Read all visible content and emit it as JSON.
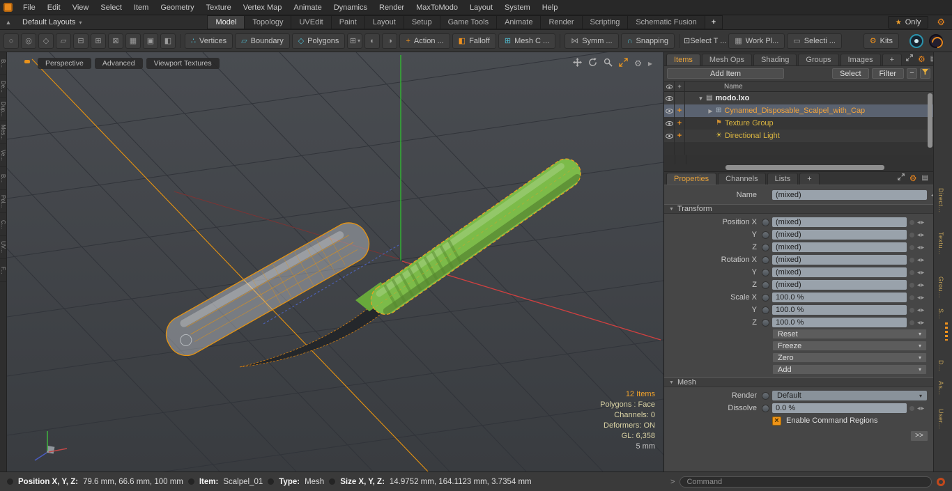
{
  "colors": {
    "accent_orange": "#f5911e",
    "selection_orange": "#f2a43e",
    "axis_green": "#2fc12f",
    "axis_red": "#d14040",
    "handle_green": "#7cbb49",
    "field_gray": "#99a2ab"
  },
  "icons": {
    "gear": "⚙",
    "star": "★",
    "dropdown": "▾",
    "triangle_down": "▼",
    "triangle_right": "▶",
    "film": "▤",
    "mesh": "⊞",
    "flag": "⚑",
    "sun": "☀",
    "plus": "+",
    "minus": "−",
    "arrows_lr": "◀▶",
    "up": "▲",
    "check_x": "×",
    "list": "▤"
  },
  "menu_bar": {
    "items": [
      "File",
      "Edit",
      "View",
      "Select",
      "Item",
      "Geometry",
      "Texture",
      "Vertex Map",
      "Animate",
      "Dynamics",
      "Render",
      "MaxToModo",
      "Layout",
      "System",
      "Help"
    ]
  },
  "layout_bar": {
    "preset": "Default Layouts",
    "tabs": [
      "Model",
      "Topology",
      "UVEdit",
      "Paint",
      "Layout",
      "Setup",
      "Game Tools",
      "Animate",
      "Render",
      "Scripting",
      "Schematic Fusion"
    ],
    "add_tab": "+",
    "only_label": "Only"
  },
  "toolbar": {
    "icon_glyphs": [
      "○",
      "◎",
      "◇",
      "▱",
      "⊟",
      "⊞",
      "⊠",
      "▦",
      "▣",
      "◧",
      "◐",
      "◑"
    ],
    "buttons": [
      {
        "label": "Vertices",
        "icon": "∴"
      },
      {
        "label": "Boundary",
        "icon": "▱"
      },
      {
        "label": "Polygons",
        "icon": "◇"
      },
      {
        "label": "Action ...",
        "icon": "+"
      },
      {
        "label": "Falloff",
        "icon": "◧"
      },
      {
        "label": "Mesh C ...",
        "icon": "⊞"
      },
      {
        "label": "Symm ...",
        "icon": "⋈"
      },
      {
        "label": "Snapping",
        "icon": "∩"
      },
      {
        "label": "Select T ...",
        "icon": "⊡"
      },
      {
        "label": "Work Pl...",
        "icon": "▦"
      },
      {
        "label": "Selecti ...",
        "icon": "▭"
      },
      {
        "label": "Kits",
        "icon": "⚙"
      }
    ]
  },
  "left_tabs": [
    "B...",
    "De...",
    "Dup...",
    "Mes...",
    "Ve...",
    "B...",
    "Pol...",
    "C...",
    "UV...",
    "F..."
  ],
  "viewport": {
    "modes": [
      "Perspective",
      "Advanced",
      "Viewport Textures"
    ],
    "info": {
      "items": "12 Items",
      "polygons": "Polygons : Face",
      "channels": "Channels: 0",
      "deformers": "Deformers: ON",
      "gl": "GL: 6,358",
      "scale": "5 mm"
    }
  },
  "item_panel": {
    "tabs": [
      "Items",
      "Mesh Ops",
      "Shading",
      "Groups",
      "Images"
    ],
    "add_tab": "+",
    "add_item": "Add Item",
    "select": "Select",
    "filter": "Filter",
    "name_header": "Name",
    "rows": [
      {
        "name": "modo.lxo"
      },
      {
        "name": "Cynamed_Disposable_Scalpel_with_Cap"
      },
      {
        "name": "Texture Group"
      },
      {
        "name": "Directional Light"
      }
    ]
  },
  "properties": {
    "tabs": [
      "Properties",
      "Channels",
      "Lists"
    ],
    "add_tab": "+",
    "name_label": "Name",
    "name_value": "(mixed)",
    "sections": {
      "transform": "Transform",
      "mesh": "Mesh"
    },
    "transform_rows": [
      {
        "label": "Position X",
        "value": "(mixed)"
      },
      {
        "label": "Y",
        "value": "(mixed)"
      },
      {
        "label": "Z",
        "value": "(mixed)"
      },
      {
        "label": "Rotation X",
        "value": "(mixed)"
      },
      {
        "label": "Y",
        "value": "(mixed)"
      },
      {
        "label": "Z",
        "value": "(mixed)"
      },
      {
        "label": "Scale X",
        "value": "100.0 %"
      },
      {
        "label": "Y",
        "value": "100.0 %"
      },
      {
        "label": "Z",
        "value": "100.0 %"
      }
    ],
    "actions": [
      "Reset",
      "Freeze",
      "Zero",
      "Add"
    ],
    "render_label": "Render",
    "render_value": "Default",
    "dissolve_label": "Dissolve",
    "dissolve_value": "0.0 %",
    "checkbox_label": "Enable Command Regions",
    "more_button": ">>"
  },
  "right_tabs": [
    "Direct...",
    "Textu...",
    "Grou...",
    "S...",
    "D...",
    "As...",
    "User..."
  ],
  "status_bar": {
    "position_label": "Position X, Y, Z:",
    "position_value": "79.6 mm, 66.6 mm, 100 mm",
    "item_label": "Item:",
    "item_value": "Scalpel_01",
    "type_label": "Type:",
    "type_value": "Mesh",
    "size_label": "Size X, Y, Z:",
    "size_value": "14.9752 mm, 164.1123 mm, 3.7354 mm"
  },
  "command_bar": {
    "prompt": ">",
    "placeholder": "Command"
  }
}
